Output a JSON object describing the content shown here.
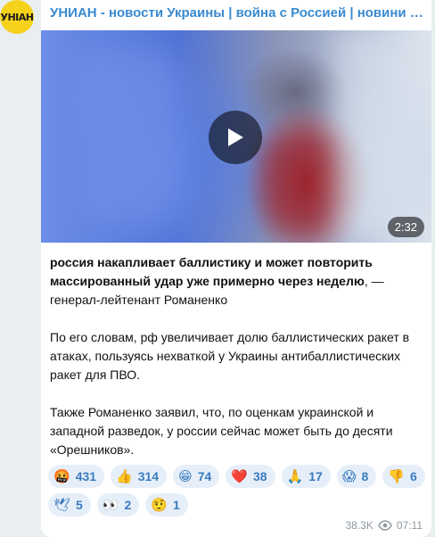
{
  "channel": {
    "avatar_text": "УНІАН",
    "title": "УНИАН - новости Украины | война с Россией | новини України"
  },
  "video": {
    "duration": "2:32"
  },
  "message": {
    "bold_lead": "россия накапливает баллистику и может повторить массированный удар уже примерно через неделю",
    "lead_rest": ", — генерал-лейтенант Романенко",
    "para2": "По его словам, рф увеличивает долю баллистических ракет в атаках, пользуясь нехваткой у Украины антибаллистических ракет для ПВО.",
    "para3": "Также Романенко заявил, что, по оценкам украинской и западной разведок, у россии сейчас может быть до десяти «Орешников»."
  },
  "reactions": [
    {
      "emoji": "🤬",
      "count": "431"
    },
    {
      "emoji": "👍",
      "count": "314"
    },
    {
      "emoji": "😁",
      "count": "74"
    },
    {
      "emoji": "❤️",
      "count": "38"
    },
    {
      "emoji": "🙏",
      "count": "17"
    },
    {
      "emoji": "😱",
      "count": "8"
    },
    {
      "emoji": "👎",
      "count": "6"
    },
    {
      "emoji": "🕊",
      "count": "5"
    },
    {
      "emoji": "👀",
      "count": "2"
    },
    {
      "emoji": "🤨",
      "count": "1"
    }
  ],
  "meta": {
    "views": "38.3K",
    "time": "07:11"
  },
  "colors": {
    "accent": "#3a8ad0",
    "avatar_bg": "#f6d21c",
    "reaction_bg": "#e6eff9"
  },
  "icons": {
    "play": "play-icon",
    "views": "eye-icon"
  }
}
